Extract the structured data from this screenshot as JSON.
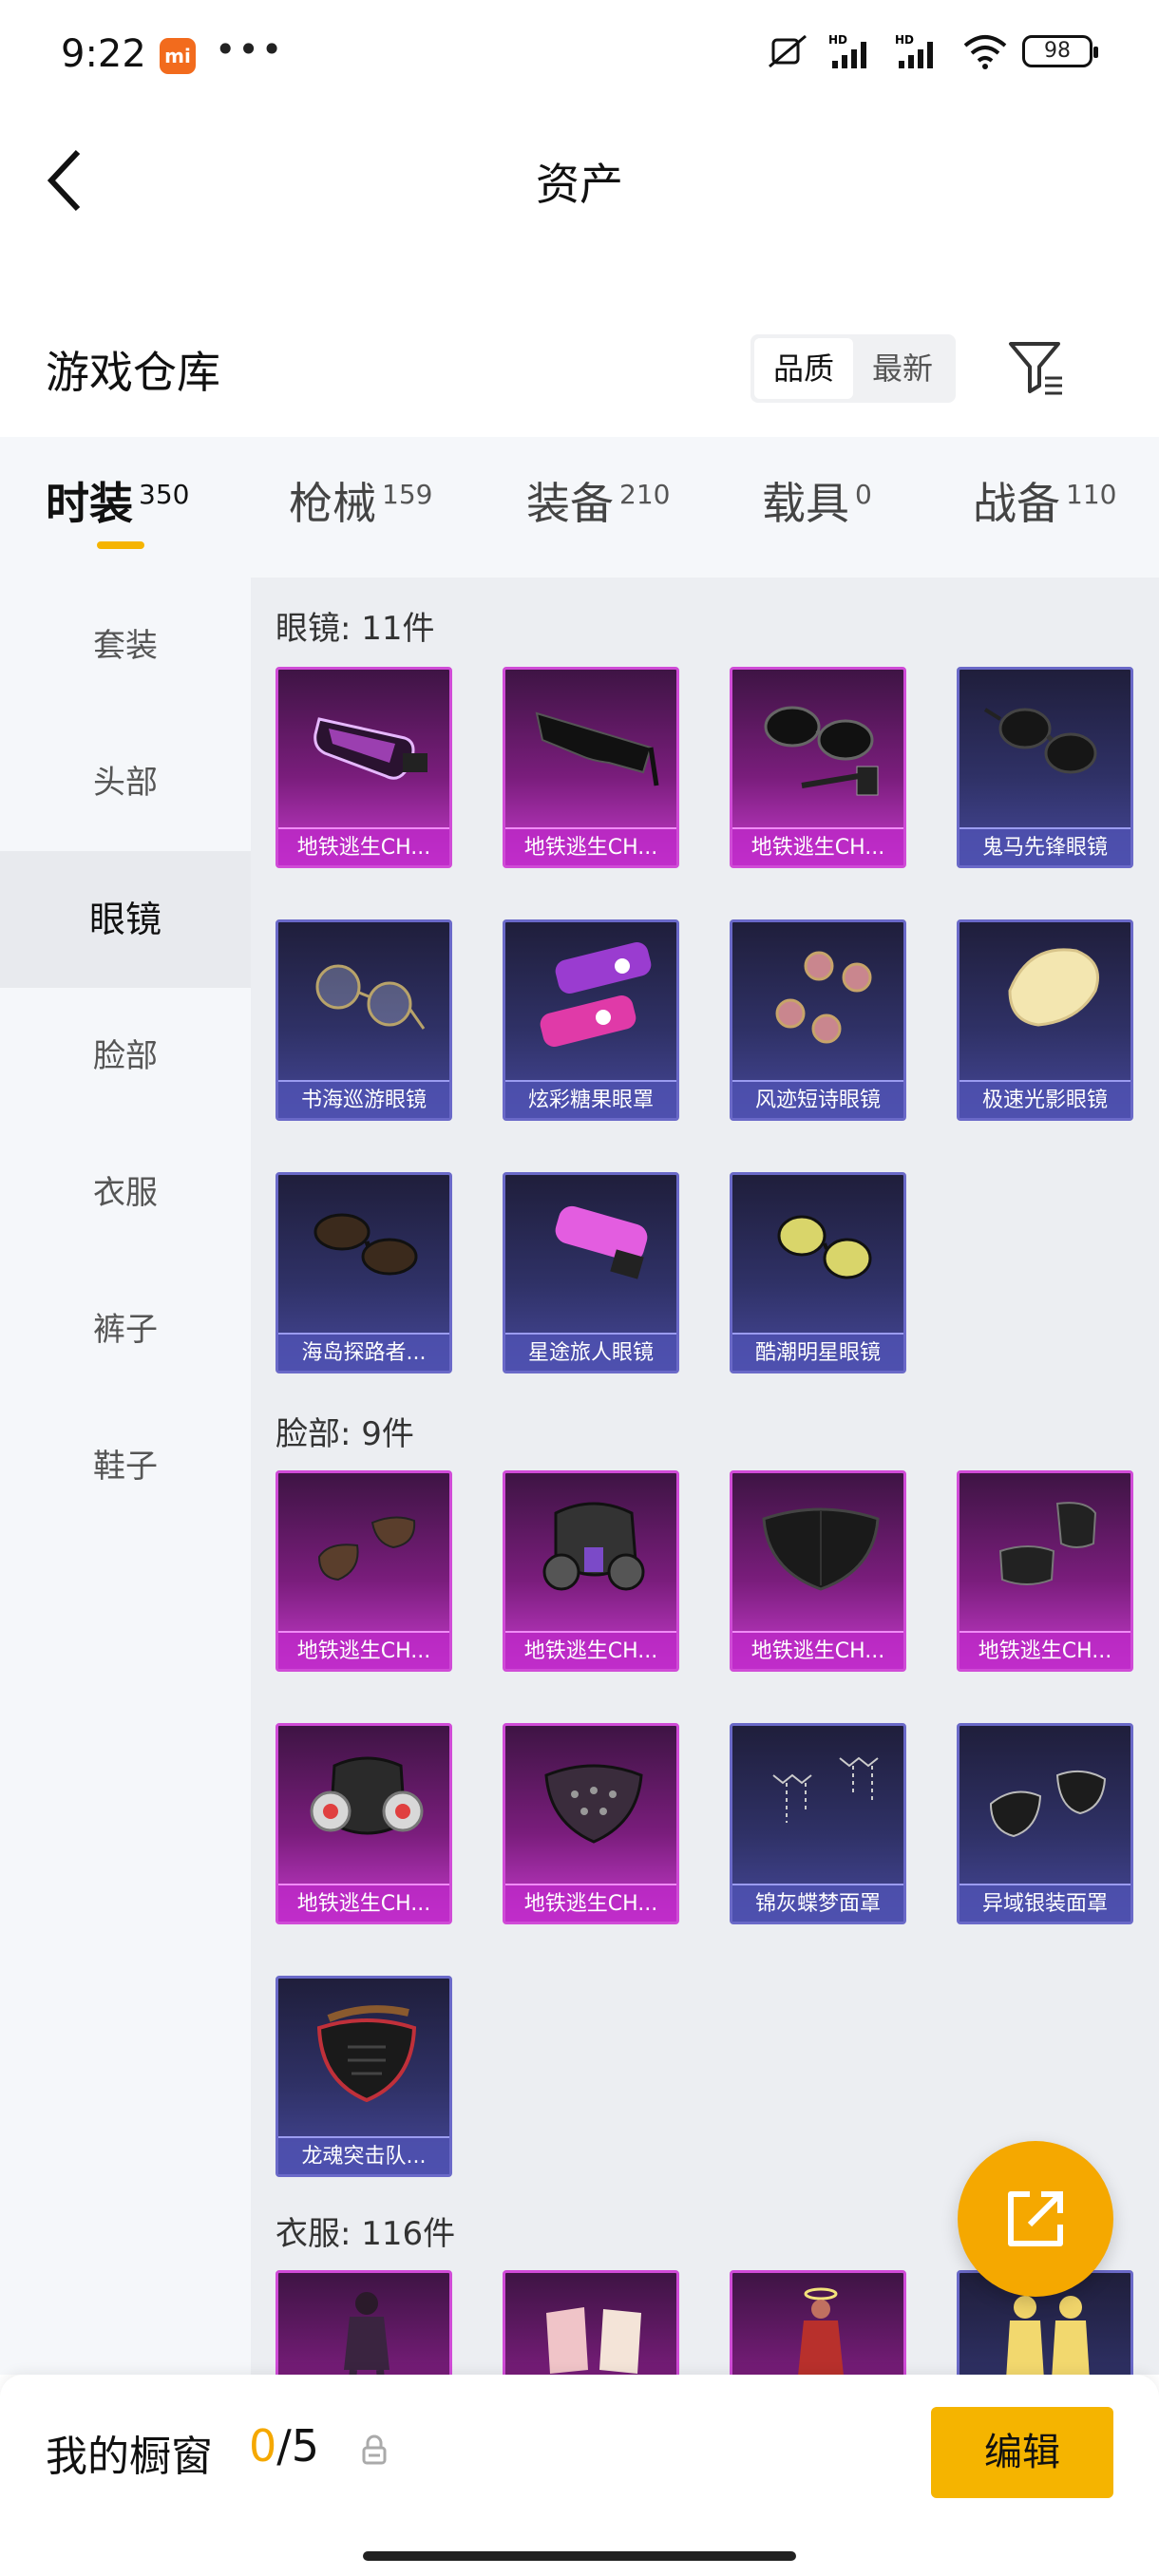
{
  "status": {
    "time": "9:22",
    "mi_badge": "mi",
    "more": "•••",
    "battery": "98"
  },
  "nav": {
    "title": "资产"
  },
  "warehouse": {
    "title": "游戏仓库",
    "sort_quality": "品质",
    "sort_newest": "最新"
  },
  "tabs": [
    {
      "label": "时装",
      "count": "350"
    },
    {
      "label": "枪械",
      "count": "159"
    },
    {
      "label": "装备",
      "count": "210"
    },
    {
      "label": "载具",
      "count": "0"
    },
    {
      "label": "战备",
      "count": "110"
    }
  ],
  "sidebar": [
    "套装",
    "头部",
    "眼镜",
    "脸部",
    "衣服",
    "裤子",
    "鞋子"
  ],
  "sections": [
    {
      "title": "眼镜: 11件",
      "items": [
        {
          "name": "地铁逃生CH...",
          "rarity": "purple",
          "icon": "goggles"
        },
        {
          "name": "地铁逃生CH...",
          "rarity": "purple",
          "icon": "shades"
        },
        {
          "name": "地铁逃生CH...",
          "rarity": "purple",
          "icon": "tech-glasses"
        },
        {
          "name": "鬼马先锋眼镜",
          "rarity": "blue",
          "icon": "sunglasses"
        },
        {
          "name": "书海巡游眼镜",
          "rarity": "blue",
          "icon": "round-glasses"
        },
        {
          "name": "炫彩糖果眼罩",
          "rarity": "blue",
          "icon": "candy-mask"
        },
        {
          "name": "风迹短诗眼镜",
          "rarity": "blue",
          "icon": "pink-round-glasses"
        },
        {
          "name": "极速光影眼镜",
          "rarity": "blue",
          "icon": "visor"
        },
        {
          "name": "海岛探路者...",
          "rarity": "blue",
          "icon": "brown-sunglasses"
        },
        {
          "name": "星途旅人眼镜",
          "rarity": "blue",
          "icon": "pink-goggles"
        },
        {
          "name": "酷潮明星眼镜",
          "rarity": "blue",
          "icon": "yellow-aviators"
        }
      ]
    },
    {
      "title": "脸部: 9件",
      "items": [
        {
          "name": "地铁逃生CH...",
          "rarity": "purple",
          "icon": "cloth-mask"
        },
        {
          "name": "地铁逃生CH...",
          "rarity": "purple",
          "icon": "gas-mask"
        },
        {
          "name": "地铁逃生CH...",
          "rarity": "purple",
          "icon": "black-mask"
        },
        {
          "name": "地铁逃生CH...",
          "rarity": "purple",
          "icon": "neck-gaiter"
        },
        {
          "name": "地铁逃生CH...",
          "rarity": "purple",
          "icon": "respirator"
        },
        {
          "name": "地铁逃生CH...",
          "rarity": "purple",
          "icon": "riveted-mask"
        },
        {
          "name": "锦灰蝶梦面罩",
          "rarity": "blue",
          "icon": "chain-veil"
        },
        {
          "name": "异域银装面罩",
          "rarity": "blue",
          "icon": "silver-mask"
        },
        {
          "name": "龙魂突击队...",
          "rarity": "blue",
          "icon": "dragon-mask"
        }
      ]
    },
    {
      "title": "衣服: 116件",
      "items": [
        {
          "name": "",
          "rarity": "purple",
          "icon": "outfit-dark"
        },
        {
          "name": "",
          "rarity": "purple",
          "icon": "outfit-pink"
        },
        {
          "name": "",
          "rarity": "purple",
          "icon": "outfit-red"
        },
        {
          "name": "",
          "rarity": "blue",
          "icon": "outfit-yellow"
        }
      ]
    }
  ],
  "bottom": {
    "label": "我的橱窗",
    "current": "0",
    "total": "/5",
    "edit": "编辑"
  }
}
